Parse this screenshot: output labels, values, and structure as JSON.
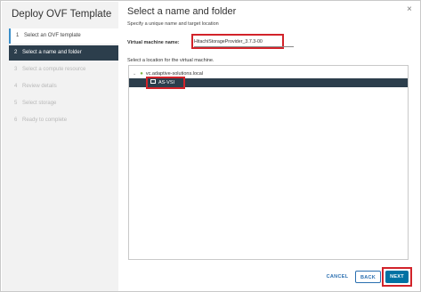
{
  "wizard": {
    "title": "Deploy OVF Template",
    "steps": [
      {
        "num": "1",
        "label": "Select an OVF template",
        "state": "done"
      },
      {
        "num": "2",
        "label": "Select a name and folder",
        "state": "active"
      },
      {
        "num": "3",
        "label": "Select a compute resource",
        "state": "disabled"
      },
      {
        "num": "4",
        "label": "Review details",
        "state": "disabled"
      },
      {
        "num": "5",
        "label": "Select storage",
        "state": "disabled"
      },
      {
        "num": "6",
        "label": "Ready to complete",
        "state": "disabled"
      }
    ]
  },
  "main": {
    "title": "Select a name and folder",
    "close_glyph": "×",
    "subtitle": "Specify a unique name and target location",
    "vm_name_label": "Virtual machine name:",
    "vm_name_value": "HitachiStorageProvider_3.7.3-00",
    "location_label": "Select a location for the virtual machine.",
    "tree": {
      "root_label": "vc.adaptive-solutions.local",
      "root_icon": "vcenter-icon",
      "selected_folder": "AS-VSI",
      "folder_icon": "folder-icon"
    }
  },
  "footer": {
    "cancel_label": "CANCEL",
    "back_label": "BACK",
    "next_label": "NEXT"
  },
  "colors": {
    "accent": "#0072a3",
    "selection": "#2c3e4c",
    "highlight": "#d2232a"
  }
}
